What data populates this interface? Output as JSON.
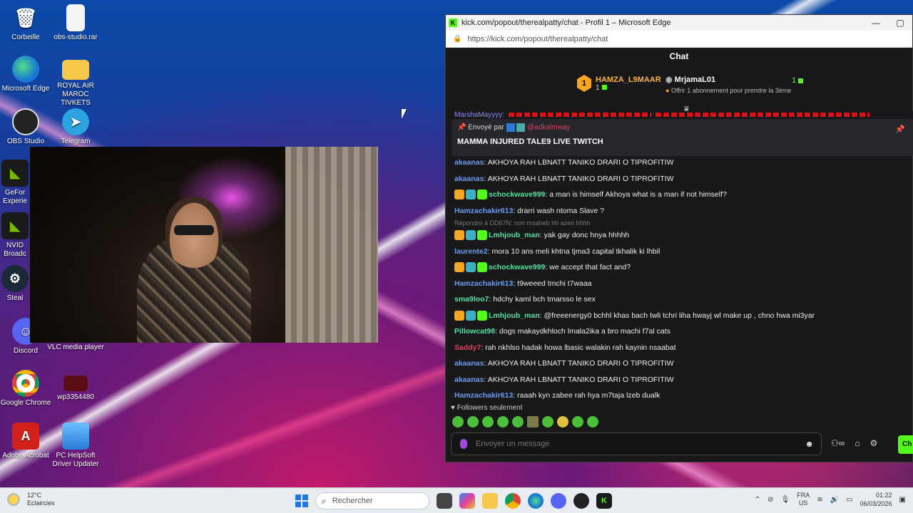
{
  "desktop": {
    "icons": [
      {
        "label": "Corbeille"
      },
      {
        "label": "obs-studio.rar"
      },
      {
        "label": "Microsoft Edge"
      },
      {
        "label": "ROYAL AIR MAROC TIVKETS"
      },
      {
        "label": "OBS Studio"
      },
      {
        "label": "Telegram"
      },
      {
        "label": "GeFor Experie"
      },
      {
        "label": "NVID Broadc"
      },
      {
        "label": "Steal"
      },
      {
        "label": "Discord"
      },
      {
        "label": "VLC media player"
      },
      {
        "label": "Google Chrome"
      },
      {
        "label": "wp3354480"
      },
      {
        "label": "Adobe Acrobat"
      },
      {
        "label": "PC HelpSoft Driver Updater"
      }
    ]
  },
  "browser": {
    "title": "kick.com/popout/therealpatty/chat - Profil 1 – Microsoft Edge",
    "url": "https://kick.com/popout/therealpatty/chat",
    "minimize": "—",
    "maximize": "▢"
  },
  "chat": {
    "header": "Chat",
    "leaderboard": {
      "first_rank": "1",
      "first_name": "HAMZA_L9MAAR",
      "first_count": "1",
      "second_name": "MrjamaL01",
      "second_sub": "Offrir 1 abonnement pour prendre la 3ème",
      "second_count": "1"
    },
    "overflow_line_user": "MarshaMayyyy:",
    "pinned": {
      "label": "Envoyé par",
      "by": "@adkalmway",
      "message": "MAMMA INJURED TALE9 LIVE TWITCH"
    },
    "messages": [
      {
        "user": "akaanas",
        "color": "#6b9bf0",
        "text": ": AKHOYA RAH LBNATT TANIKO DRARI O TIPROFITIW",
        "badges": 0
      },
      {
        "user": "akaanas",
        "color": "#6b9bf0",
        "text": ": AKHOYA RAH LBNATT TANIKO DRARI O TIPROFITIW",
        "badges": 0
      },
      {
        "user": "schockwave999",
        "color": "#58e0a0",
        "text": ": a man is himself Akhoya what is a man if not himself?",
        "badges": 3
      },
      {
        "user": "Hamzachakir613",
        "color": "#6b9bf0",
        "text": ": drarri wash ntoma Slave ?",
        "badges": 0
      },
      {
        "user": "Lmhjoub_man",
        "color": "#58e0a0",
        "text": ": yak gay donc hnya hhhhh",
        "badges": 3
      },
      {
        "user": "laurente2",
        "color": "#6b9bf0",
        "text": ": mora 10 ans meli khtna tjma3 capital tkhalik ki lhbil",
        "badges": 0
      },
      {
        "user": "schockwave999",
        "color": "#58e0a0",
        "text": ": we accept that fact and?",
        "badges": 3
      },
      {
        "user": "Hamzachakir613",
        "color": "#6b9bf0",
        "text": ": t9weeed tmchi t7waaa",
        "badges": 0
      },
      {
        "user": "sma9loo7",
        "color": "#58e0a0",
        "text": ": hdchy kaml bch tmarsso le sex",
        "badges": 0
      },
      {
        "user": "Lmhjoub_man",
        "color": "#58e0a0",
        "text": ": @freeenergy0 bchhl khas bach twli tchri liha hwayj wl make up , chno hwa mi3yar",
        "badges": 3
      },
      {
        "user": "Pillowcat98",
        "color": "#58e0a0",
        "text": ": dogs makaydkhloch lmala2ika a bro machi f7al cats",
        "badges": 0
      },
      {
        "user": "Saddy7",
        "color": "#e04060",
        "text": ": rah nkhlso hadak howa lbasic walakin rah kaynin nsaabat",
        "badges": 0
      },
      {
        "user": "akaanas",
        "color": "#6b9bf0",
        "text": ": AKHOYA RAH LBNATT TANIKO DRARI O TIPROFITIW",
        "badges": 0
      },
      {
        "user": "akaanas",
        "color": "#6b9bf0",
        "text": ": AKHOYA RAH LBNATT TANIKO DRARI O TIPROFITIW",
        "badges": 0
      },
      {
        "user": "Hamzachakir613",
        "color": "#6b9bf0",
        "text": ": raaah kyn zabee rah hya m7taja lzeb dualk",
        "badges": 0
      }
    ],
    "reply_note": "Répondre à DD67N: non msaheb hh azen hhhh",
    "followers_only": "Followers seulement",
    "input_placeholder": "Envoyer un message",
    "send_label": "Ch"
  },
  "taskbar": {
    "temp": "12°C",
    "weather": "Eclaircies",
    "search_placeholder": "Rechercher",
    "lang_top": "FRA",
    "lang_bottom": "US",
    "time": "01:22",
    "date": "06/03/2026"
  }
}
